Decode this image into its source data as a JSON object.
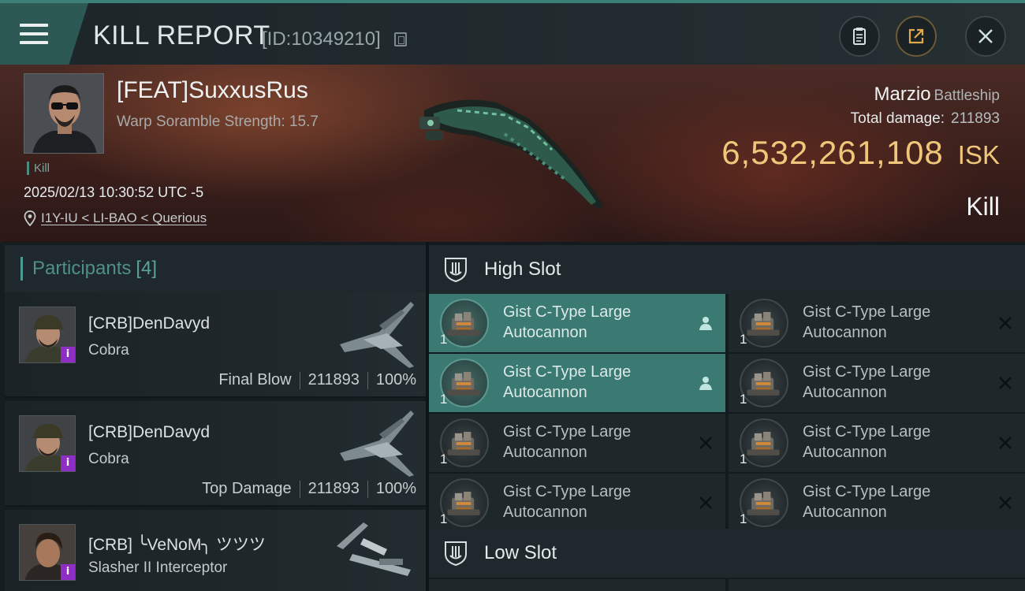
{
  "header": {
    "title": "KILL REPORT",
    "report_id": "[ID:10349210]",
    "icons": [
      "menu-icon",
      "copy-icon",
      "clipboard-icon",
      "share-icon",
      "close-icon"
    ]
  },
  "victim": {
    "name": "[FEAT]SuxxusRus",
    "scramble": "Warp Soramble Strength: 15.7",
    "kill_tag": "Kill",
    "datetime": "2025/02/13 10:30:52 UTC -5",
    "location": "I1Y-IU < LI-BAO < Querious",
    "ship_name": "Marzio",
    "ship_class": "Battleship",
    "damage_label": "Total damage:",
    "damage_value": "211893",
    "isk_value": "6,532,261,108",
    "isk_unit": "ISK",
    "result": "Kill"
  },
  "participants": {
    "label": "Participants",
    "count": "[4]",
    "items": [
      {
        "name": "[CRB]DenDavyd",
        "ship": "Cobra",
        "role": "Final Blow",
        "damage": "211893",
        "percent": "100%"
      },
      {
        "name": "[CRB]DenDavyd",
        "ship": "Cobra",
        "role": "Top Damage",
        "damage": "211893",
        "percent": "100%"
      },
      {
        "name": "[CRB] ╰VeNoM╮ ツツツ",
        "ship": "Slasher II Interceptor",
        "role": "",
        "damage": "",
        "percent": ""
      }
    ]
  },
  "fitting": {
    "high_slot_label": "High Slot",
    "low_slot_label": "Low Slot",
    "high_modules": [
      {
        "name": "Gist C-Type Large Autocannon",
        "qty": "1",
        "status": "pilot-icon",
        "highlighted": true
      },
      {
        "name": "Gist C-Type Large Autocannon",
        "qty": "1",
        "status": "x-icon",
        "highlighted": false
      },
      {
        "name": "Gist C-Type Large Autocannon",
        "qty": "1",
        "status": "pilot-icon",
        "highlighted": true
      },
      {
        "name": "Gist C-Type Large Autocannon",
        "qty": "1",
        "status": "x-icon",
        "highlighted": false
      },
      {
        "name": "Gist C-Type Large Autocannon",
        "qty": "1",
        "status": "x-icon",
        "highlighted": false
      },
      {
        "name": "Gist C-Type Large Autocannon",
        "qty": "1",
        "status": "x-icon",
        "highlighted": false
      },
      {
        "name": "Gist C-Type Large Autocannon",
        "qty": "1",
        "status": "x-icon",
        "highlighted": false
      },
      {
        "name": "Gist C-Type Large Autocannon",
        "qty": "1",
        "status": "x-icon",
        "highlighted": false
      }
    ]
  },
  "colors": {
    "accent": "#3a7a73",
    "isk": "#f0c77a",
    "badge": "#8e2ec4"
  }
}
